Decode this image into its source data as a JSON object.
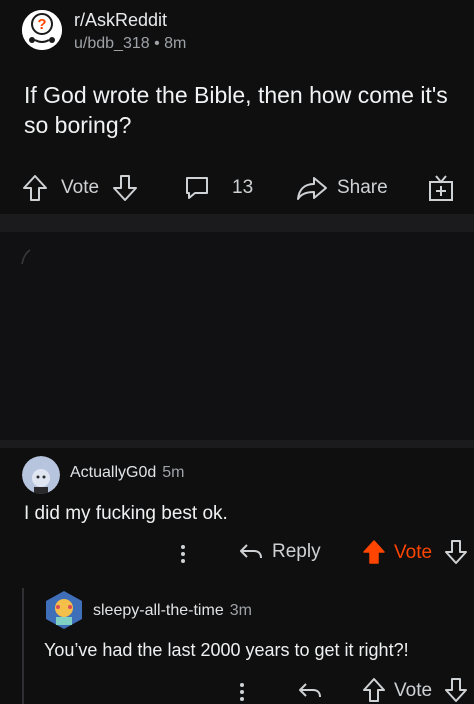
{
  "post": {
    "subreddit": "r/AskReddit",
    "author": "u/bdb_318",
    "age": "8m",
    "meta_separator": "•",
    "title": "If God wrote the Bible, then how come it's so boring?",
    "vote_label": "Vote",
    "comment_count": "13",
    "share_label": "Share"
  },
  "comments": [
    {
      "author": "ActuallyG0d",
      "time": "5m",
      "body": "I did my fucking best ok.",
      "reply_label": "Reply",
      "vote_label": "Vote",
      "upvoted": true
    },
    {
      "author": "sleepy-all-the-time",
      "time": "3m",
      "body": "You’ve had the last 2000 years to get it right?!",
      "vote_label": "Vote",
      "upvoted": false
    }
  ],
  "colors": {
    "background": "#0f0f10",
    "upvote_active": "#ff4500",
    "text": "#d7dadc"
  },
  "icons": [
    "askreddit-icon",
    "upvote-icon",
    "downvote-icon",
    "comment-icon",
    "share-icon",
    "award-icon",
    "more-icon",
    "reply-icon"
  ]
}
